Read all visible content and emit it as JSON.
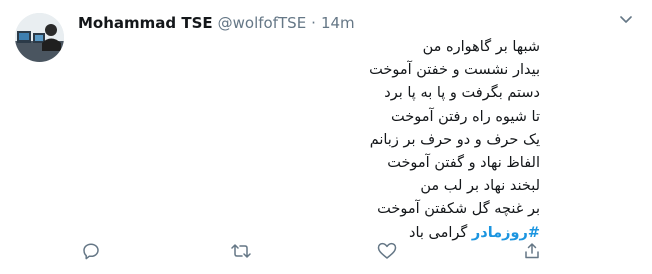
{
  "tweet": {
    "author_name": "Mohammad TSE",
    "handle": "@wolfofTSE",
    "separator": "·",
    "timestamp": "14m",
    "lines": [
      "شبها بر گاهواره من",
      "بیدار نشست و خفتن آموخت",
      "دستم بگرفت و پا به پا برد",
      "تا شیوه راه رفتن آموخت",
      "یک حرف و دو حرف بر زبانم",
      "الفاظ نهاد و گفتن آموخت",
      "لبخند نهاد بر لب من",
      "بر غنچه گل شکفتن آموخت"
    ],
    "last_line_hashtag": "#روزمادر",
    "last_line_text": " گرامی باد"
  },
  "icons": {
    "menu": "chevron-down-icon",
    "reply": "reply-icon",
    "retweet": "retweet-icon",
    "like": "like-icon",
    "share": "share-icon"
  },
  "colors": {
    "text": "#14171a",
    "secondary": "#657786",
    "link": "#1b95e0",
    "icon": "#657786"
  }
}
